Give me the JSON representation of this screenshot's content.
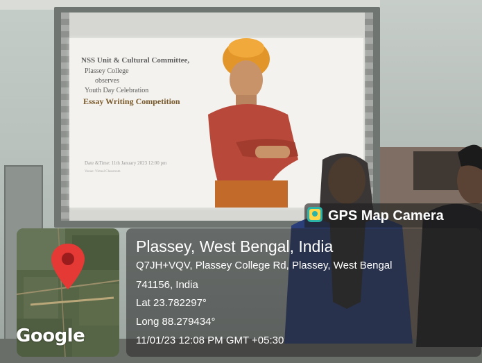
{
  "slide": {
    "line1": "NSS Unit & Cultural Committee,",
    "line2": "Plassey College",
    "line3": "observes",
    "line4": "Youth Day Celebration",
    "line5": "Essay Writing Competition",
    "line6": "Date &Time: 11th January 2023 12:00 pm",
    "line7": "Venue: Virtual Classroom"
  },
  "watermark": {
    "app_name": "GPS Map Camera",
    "app_icon": "gps-map-camera-icon",
    "map_logo": "Google",
    "map_pin": "map-pin-icon",
    "place_title": "Plassey, West Bengal, India",
    "address_line1": "Q7JH+VQV, Plassey College Rd, Plassey, West Bengal",
    "address_line2": "741156, India",
    "latitude": "Lat 23.782297°",
    "longitude": "Long 88.279434°",
    "datetime": "11/01/23 12:08 PM GMT +05:30"
  },
  "colors": {
    "pin": "#e53935",
    "overlay": "#282828",
    "gps_icon": "#2bb3a8"
  }
}
